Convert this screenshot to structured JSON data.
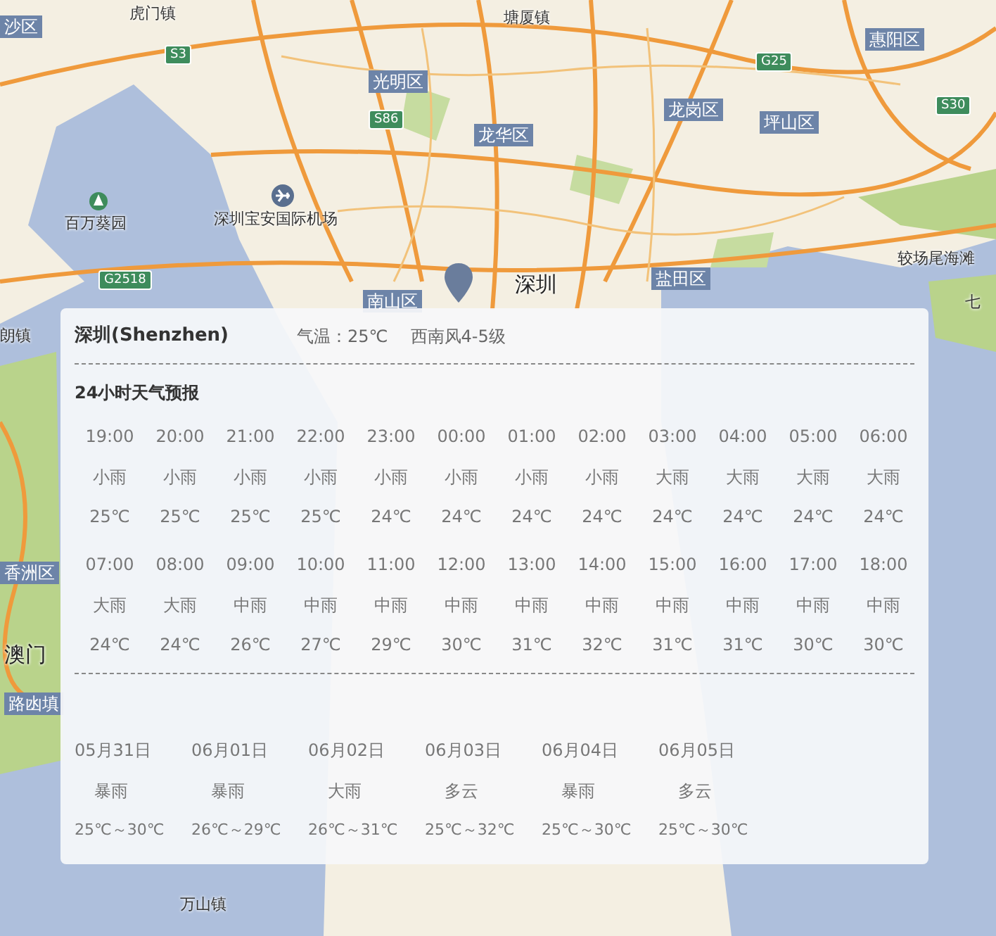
{
  "map": {
    "labels": [
      {
        "text": "沙区",
        "kind": "district"
      },
      {
        "text": "虎门镇",
        "kind": "place"
      },
      {
        "text": "塘厦镇",
        "kind": "place"
      },
      {
        "text": "S3",
        "kind": "road"
      },
      {
        "text": "G25",
        "kind": "road"
      },
      {
        "text": "惠阳区",
        "kind": "district"
      },
      {
        "text": "光明区",
        "kind": "district"
      },
      {
        "text": "S86",
        "kind": "road"
      },
      {
        "text": "S30",
        "kind": "road"
      },
      {
        "text": "龙岗区",
        "kind": "district"
      },
      {
        "text": "坪山区",
        "kind": "district"
      },
      {
        "text": "龙华区",
        "kind": "district"
      },
      {
        "text": "百万葵园",
        "kind": "place"
      },
      {
        "text": "深圳宝安国际机场",
        "kind": "place"
      },
      {
        "text": "较场尾海滩",
        "kind": "place"
      },
      {
        "text": "G2518",
        "kind": "road"
      },
      {
        "text": "深圳",
        "kind": "city"
      },
      {
        "text": "盐田区",
        "kind": "district"
      },
      {
        "text": "南山区",
        "kind": "district"
      },
      {
        "text": "七",
        "kind": "place"
      },
      {
        "text": "朗镇",
        "kind": "place"
      },
      {
        "text": "香洲区",
        "kind": "district"
      },
      {
        "text": "澳门",
        "kind": "city"
      },
      {
        "text": "路凼填",
        "kind": "district"
      },
      {
        "text": "万山镇",
        "kind": "place"
      }
    ]
  },
  "popup": {
    "city": "深圳(Shenzhen)",
    "temperature": "气温：25℃",
    "wind": "西南风4-5级",
    "hourly_title": "24小时天气预报",
    "hourly": [
      {
        "time": "19:00",
        "weather": "小雨",
        "temp": "25℃"
      },
      {
        "time": "20:00",
        "weather": "小雨",
        "temp": "25℃"
      },
      {
        "time": "21:00",
        "weather": "小雨",
        "temp": "25℃"
      },
      {
        "time": "22:00",
        "weather": "小雨",
        "temp": "25℃"
      },
      {
        "time": "23:00",
        "weather": "小雨",
        "temp": "24℃"
      },
      {
        "time": "00:00",
        "weather": "小雨",
        "temp": "24℃"
      },
      {
        "time": "01:00",
        "weather": "小雨",
        "temp": "24℃"
      },
      {
        "time": "02:00",
        "weather": "小雨",
        "temp": "24℃"
      },
      {
        "time": "03:00",
        "weather": "大雨",
        "temp": "24℃"
      },
      {
        "time": "04:00",
        "weather": "大雨",
        "temp": "24℃"
      },
      {
        "time": "05:00",
        "weather": "大雨",
        "temp": "24℃"
      },
      {
        "time": "06:00",
        "weather": "大雨",
        "temp": "24℃"
      },
      {
        "time": "07:00",
        "weather": "大雨",
        "temp": "24℃"
      },
      {
        "time": "08:00",
        "weather": "大雨",
        "temp": "24℃"
      },
      {
        "time": "09:00",
        "weather": "中雨",
        "temp": "26℃"
      },
      {
        "time": "10:00",
        "weather": "中雨",
        "temp": "27℃"
      },
      {
        "time": "11:00",
        "weather": "中雨",
        "temp": "29℃"
      },
      {
        "time": "12:00",
        "weather": "中雨",
        "temp": "30℃"
      },
      {
        "time": "13:00",
        "weather": "中雨",
        "temp": "31℃"
      },
      {
        "time": "14:00",
        "weather": "中雨",
        "temp": "32℃"
      },
      {
        "time": "15:00",
        "weather": "中雨",
        "temp": "31℃"
      },
      {
        "time": "16:00",
        "weather": "中雨",
        "temp": "31℃"
      },
      {
        "time": "17:00",
        "weather": "中雨",
        "temp": "30℃"
      },
      {
        "time": "18:00",
        "weather": "中雨",
        "temp": "30℃"
      }
    ],
    "daily": [
      {
        "date": "05月31日",
        "weather": "暴雨",
        "range": "25℃～30℃"
      },
      {
        "date": "06月01日",
        "weather": "暴雨",
        "range": "26℃～29℃"
      },
      {
        "date": "06月02日",
        "weather": "大雨",
        "range": "26℃～31℃"
      },
      {
        "date": "06月03日",
        "weather": "多云",
        "range": "25℃～32℃"
      },
      {
        "date": "06月04日",
        "weather": "暴雨",
        "range": "25℃～30℃"
      },
      {
        "date": "06月05日",
        "weather": "多云",
        "range": "25℃～30℃"
      }
    ]
  }
}
